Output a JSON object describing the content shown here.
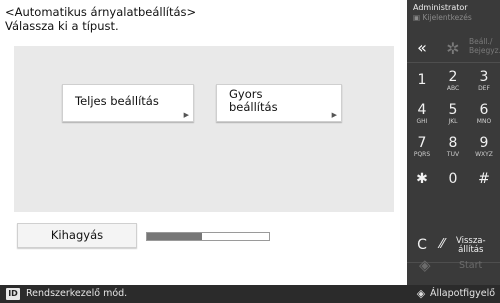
{
  "title_line1": "<Automatikus árnyalatbeállítás>",
  "title_line2": "Válassza ki a típust.",
  "options": [
    {
      "label_line1": "Teljes beállítás",
      "label_line2": ""
    },
    {
      "label_line1": "Gyors",
      "label_line2": "beállítás"
    }
  ],
  "skip_label": "Kihagyás",
  "progress_fraction": 0.45,
  "status": {
    "id_icon": "ID",
    "message": "Rendszerkezelő mód.",
    "monitor_icon": "status-monitor-icon",
    "monitor_label": "Állapotfigyelő"
  },
  "panel": {
    "user": "Administrator",
    "logout": "Kijelentkezés",
    "back_icon": "double-chevron-left-icon",
    "settings_line1": "Beáll./",
    "settings_line2": "Bejegyz.",
    "keys": [
      {
        "digit": "1",
        "letters": ""
      },
      {
        "digit": "2",
        "letters": "ABC"
      },
      {
        "digit": "3",
        "letters": "DEF"
      },
      {
        "digit": "4",
        "letters": "GHI"
      },
      {
        "digit": "5",
        "letters": "JKL"
      },
      {
        "digit": "6",
        "letters": "MNO"
      },
      {
        "digit": "7",
        "letters": "PQRS"
      },
      {
        "digit": "8",
        "letters": "TUV"
      },
      {
        "digit": "9",
        "letters": "WXYZ"
      },
      {
        "digit": "✱",
        "letters": ""
      },
      {
        "digit": "0",
        "letters": ""
      },
      {
        "digit": "#",
        "letters": ""
      }
    ],
    "clear": "C",
    "reset_line1": "Vissza-",
    "reset_line2": "állítás",
    "start": "Start"
  }
}
